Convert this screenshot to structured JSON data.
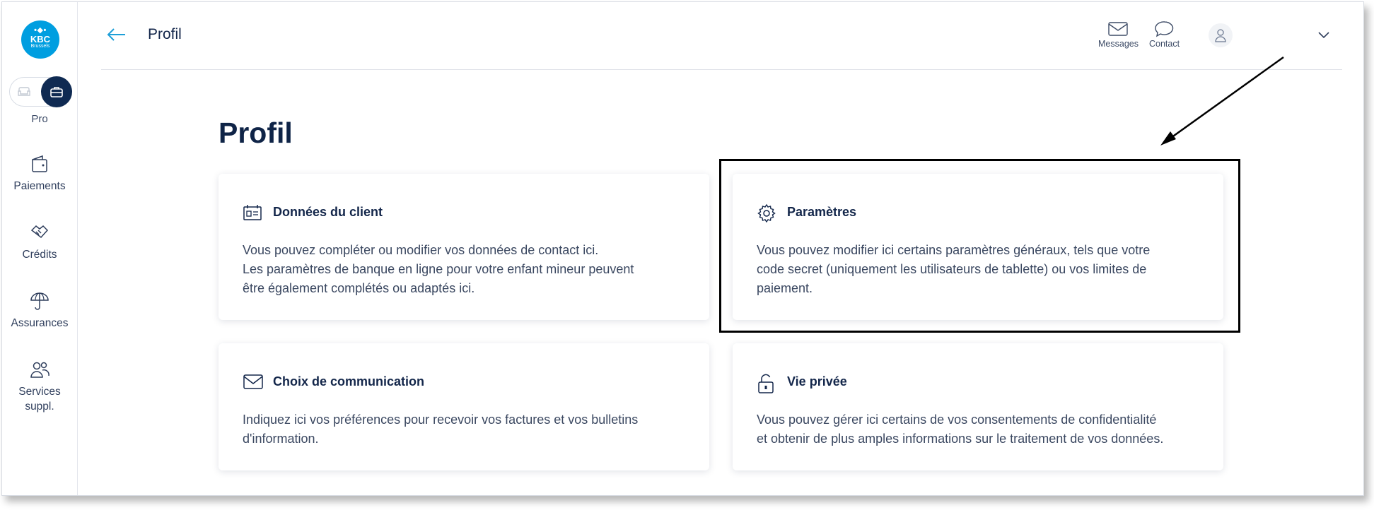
{
  "sidebar": {
    "logo": {
      "mark": "•◆•",
      "brand": "KBC",
      "city": "Brussels"
    },
    "mode_label": "Pro",
    "items": [
      {
        "label": "Paiements",
        "icon": "wallet-icon"
      },
      {
        "label": "Crédits",
        "icon": "handshake-icon"
      },
      {
        "label": "Assurances",
        "icon": "umbrella-icon"
      },
      {
        "label_line1": "Services",
        "label_line2": "suppl.",
        "icon": "users-icon"
      }
    ]
  },
  "header": {
    "title": "Profil",
    "messages_label": "Messages",
    "contact_label": "Contact"
  },
  "main": {
    "title": "Profil",
    "cards": [
      {
        "title": "Données du client",
        "icon": "id-card-icon",
        "desc": [
          "Vous pouvez compléter ou modifier vos données de contact ici.",
          "Les paramètres de banque en ligne pour votre enfant mineur peuvent",
          "être également complétés ou adaptés ici."
        ]
      },
      {
        "title": "Paramètres",
        "icon": "gear-icon",
        "desc": [
          "Vous pouvez modifier ici certains paramètres généraux, tels que votre",
          "code secret (uniquement les utilisateurs de tablette) ou vos limites de",
          "paiement."
        ]
      },
      {
        "title": "Choix de communication",
        "icon": "envelope-icon",
        "desc": [
          "Indiquez ici vos préférences pour recevoir vos factures et vos bulletins",
          "d'information."
        ]
      },
      {
        "title": "Vie privée",
        "icon": "unlock-icon",
        "desc": [
          "Vous pouvez gérer ici certains de vos consentements de confidentialité",
          "et obtenir de plus amples informations sur le traitement de vos données."
        ]
      }
    ]
  },
  "colors": {
    "brand_blue": "#009ee0",
    "navy": "#0f2a52",
    "text": "#3a4760"
  }
}
